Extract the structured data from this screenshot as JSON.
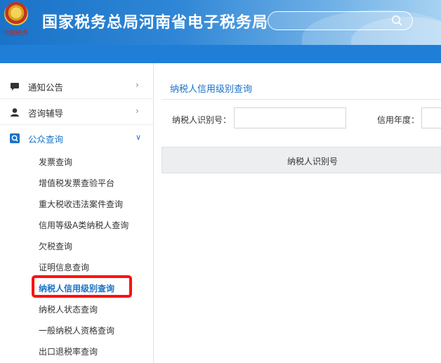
{
  "header": {
    "title": "国家税务总局河南省电子税务局",
    "emblem_caption": "中国税务",
    "search": {
      "value": "",
      "icon": "search-icon"
    }
  },
  "sidebar": {
    "sections": [
      {
        "label": "通知公告",
        "icon": "message-icon",
        "expanded": false
      },
      {
        "label": "咨询辅导",
        "icon": "person-icon",
        "expanded": false
      },
      {
        "label": "公众查询",
        "icon": "query-icon",
        "expanded": true
      }
    ],
    "subitems": [
      "发票查询",
      "增值税发票查验平台",
      "重大税收违法案件查询",
      "信用等级A类纳税人查询",
      "欠税查询",
      "证明信息查询",
      "纳税人信用级别查询",
      "纳税人状态查询",
      "一般纳税人资格查询",
      "出口退税率查询"
    ],
    "current_item": "纳税人信用级别查询"
  },
  "content": {
    "title": "纳税人信用级别查询",
    "form": {
      "taxpayer_id_label": "纳税人识别号：",
      "taxpayer_id_value": "",
      "credit_year_label": "信用年度：",
      "credit_year_value": ""
    },
    "table": {
      "columns": [
        "纳税人识别号"
      ]
    }
  },
  "colors": {
    "accent": "#1a73c8",
    "header_bar": "#1f7fd8",
    "highlight": "#ff1010"
  }
}
